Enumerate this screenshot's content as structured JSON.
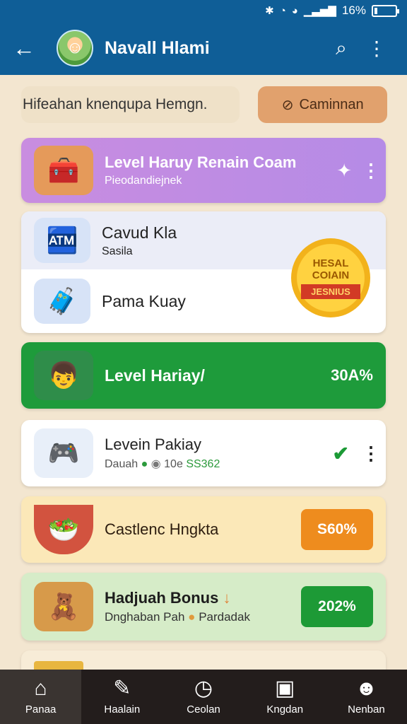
{
  "status": {
    "battery_text": "16%",
    "battery_level": 0.16
  },
  "appbar": {
    "title": "Navall Hlami"
  },
  "filter": {
    "text": "Hifeahan knenqupa Hemgn.",
    "button_label": "Caminnan"
  },
  "cards": [
    {
      "title": "Level Haruy Renain Coam",
      "subtitle": "Pieodandiejnek"
    },
    {
      "title": "Cavud Kla",
      "subtitle": "Sasila",
      "title2": "Pama Kuay",
      "badge_line1": "HESAL",
      "badge_line2": "COIAIN",
      "badge_ribbon": "JESNIUS"
    },
    {
      "title": "Level Hariay/",
      "percent": "30A%"
    },
    {
      "title": "Levein Pakiay",
      "subtitle_a": "Dauah",
      "subtitle_b": "10e",
      "subtitle_c": "SS362"
    },
    {
      "title": "Castlenc Hngkta",
      "percent": "S60%"
    },
    {
      "title": "Hadjuah Bonus",
      "subtitle": "Dnghaban Pah",
      "subtitle_b": "Pardadak",
      "percent": "202%"
    }
  ],
  "tabs": [
    {
      "label": "Panaa",
      "icon": "home-icon"
    },
    {
      "label": "Haalain",
      "icon": "edit-icon"
    },
    {
      "label": "Ceolan",
      "icon": "clock-icon"
    },
    {
      "label": "Kngdan",
      "icon": "bag-icon"
    },
    {
      "label": "Nenban",
      "icon": "user-icon"
    }
  ]
}
